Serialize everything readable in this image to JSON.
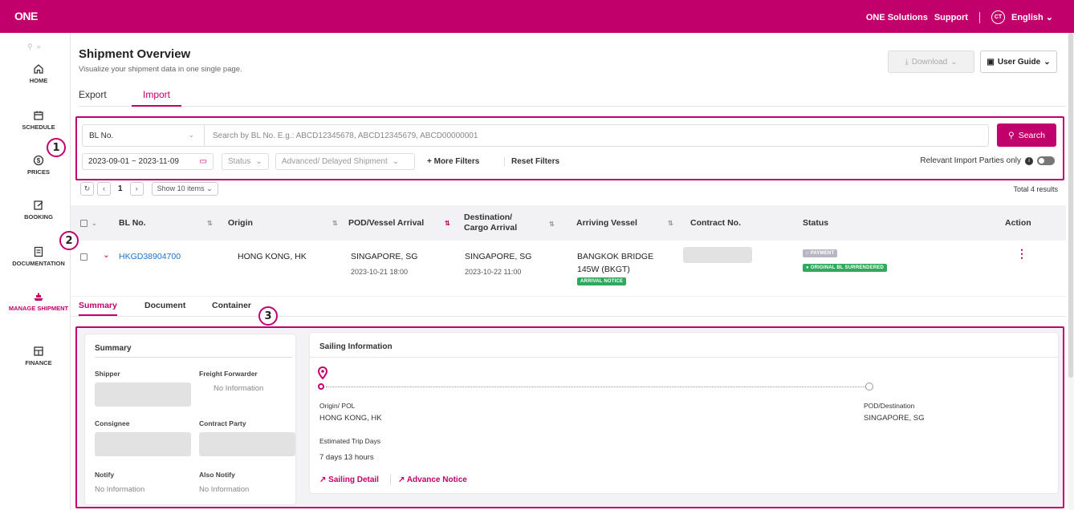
{
  "app": {
    "logo": "ONE"
  },
  "topnav": {
    "solutions": "ONE Solutions",
    "support": "Support",
    "avatar": "CT",
    "language": "English"
  },
  "sidebar": {
    "items": [
      {
        "label": "HOME",
        "icon": "home-icon"
      },
      {
        "label": "SCHEDULE",
        "icon": "calendar-icon"
      },
      {
        "label": "PRICES",
        "icon": "dollar-icon"
      },
      {
        "label": "BOOKING",
        "icon": "booking-icon"
      },
      {
        "label": "DOCUMENTATION",
        "icon": "document-icon"
      },
      {
        "label": "MANAGE SHIPMENT",
        "icon": "ship-icon"
      },
      {
        "label": "FINANCE",
        "icon": "finance-icon"
      }
    ],
    "active": "MANAGE SHIPMENT"
  },
  "header": {
    "title": "Shipment Overview",
    "subtitle": "Visualize your shipment data in one single page.",
    "download": "Download",
    "user_guide": "User Guide"
  },
  "tabs": [
    "Export",
    "Import"
  ],
  "active_tab": "Import",
  "filters": {
    "bl_select": "BL No.",
    "search_placeholder": "Search by BL No. E.g.: ABCD12345678, ABCD12345679, ABCD00000001",
    "search_button": "Search",
    "date_range": "2023-09-01 ~ 2023-11-09",
    "status": "Status",
    "advanced": "Advanced/ Delayed Shipment",
    "more_filters": "+ More Filters",
    "reset_filters": "Reset Filters",
    "relevant_label": "Relevant Import Parties only"
  },
  "pager": {
    "page": "1",
    "show": "Show 10 items",
    "total": "Total 4 results"
  },
  "table": {
    "headers": {
      "bl": "BL No.",
      "origin": "Origin",
      "pod": "POD/Vessel Arrival",
      "dest1": "Destination/",
      "dest2": "Cargo Arrival",
      "vessel": "Arriving Vessel",
      "contract": "Contract No.",
      "status": "Status",
      "action": "Action"
    },
    "row": {
      "bl": "HKGD38904700",
      "origin": "HONG KONG, HK",
      "pod": "SINGAPORE, SG",
      "pod_time": "2023-10-21  18:00",
      "dest": "SINGAPORE, SG",
      "dest_time": "2023-10-22  11:00",
      "vessel": "BANGKOK BRIDGE",
      "voyage": "145W (BKGT)",
      "vessel_badge": "ARRIVAL NOTICE",
      "status_badges": [
        "PAYMENT",
        "ORIGINAL BL SURRENDERED"
      ]
    }
  },
  "subtabs": [
    "Summary",
    "Document",
    "Container"
  ],
  "summary": {
    "title": "Summary",
    "shipper": "Shipper",
    "freight_forwarder": "Freight Forwarder",
    "ff_value": "No Information",
    "consignee": "Consignee",
    "contract_party": "Contract Party",
    "notify": "Notify",
    "notify_value": "No Information",
    "also_notify": "Also Notify",
    "also_notify_value": "No Information"
  },
  "sailing": {
    "title": "Sailing Information",
    "origin_label": "Origin/ POL",
    "origin_value": "HONG KONG, HK",
    "dest_label": "POD/Destination",
    "dest_value": "SINGAPORE, SG",
    "trip_label": "Estimated Trip Days",
    "trip_value": "7 days 13 hours",
    "sailing_detail": "Sailing Detail",
    "advance_notice": "Advance Notice"
  },
  "annotations": [
    "1",
    "2",
    "3"
  ],
  "colors": {
    "brand": "#c2006b",
    "link": "#1a73c9",
    "success": "#2eaa5c",
    "muted_badge": "#b7b7c2"
  }
}
